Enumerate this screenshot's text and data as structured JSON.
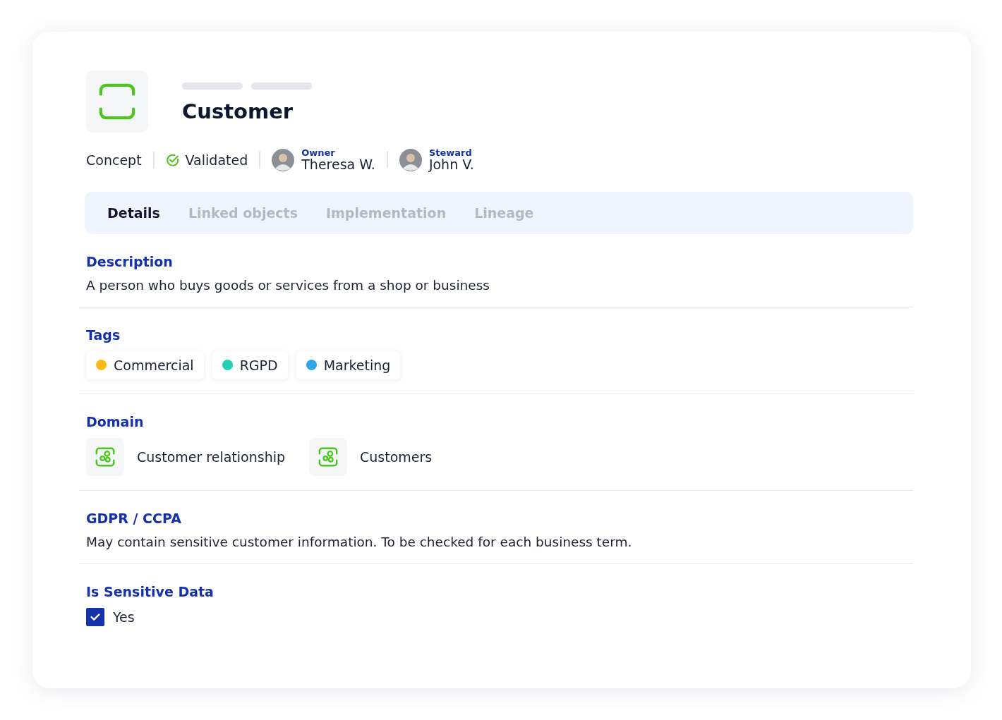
{
  "header": {
    "title": "Customer",
    "type": "Concept",
    "status": "Validated",
    "owner": {
      "role": "Owner",
      "name": "Theresa W."
    },
    "steward": {
      "role": "Steward",
      "name": "John V."
    }
  },
  "tabs": [
    {
      "label": "Details",
      "selected": true
    },
    {
      "label": "Linked objects",
      "selected": false
    },
    {
      "label": "Implementation",
      "selected": false
    },
    {
      "label": "Lineage",
      "selected": false
    }
  ],
  "sections": [
    {
      "kind": "text",
      "title": "Description",
      "text": "A person who buys goods or services from a shop or business"
    },
    {
      "kind": "tags",
      "title": "Tags",
      "tags": [
        {
          "label": "Commercial",
          "color": "#fbb917"
        },
        {
          "label": "RGPD",
          "color": "#21d0b2"
        },
        {
          "label": "Marketing",
          "color": "#2fa6e8"
        }
      ]
    },
    {
      "kind": "domains",
      "title": "Domain",
      "domains": [
        "Customer relationship",
        "Customers"
      ]
    },
    {
      "kind": "text",
      "title": "GDPR / CCPA",
      "text": "May contain sensitive customer information. To be checked for each business term."
    },
    {
      "kind": "checkbox",
      "title": "Is Sensitive Data",
      "label": "Yes",
      "checked": true
    }
  ]
}
